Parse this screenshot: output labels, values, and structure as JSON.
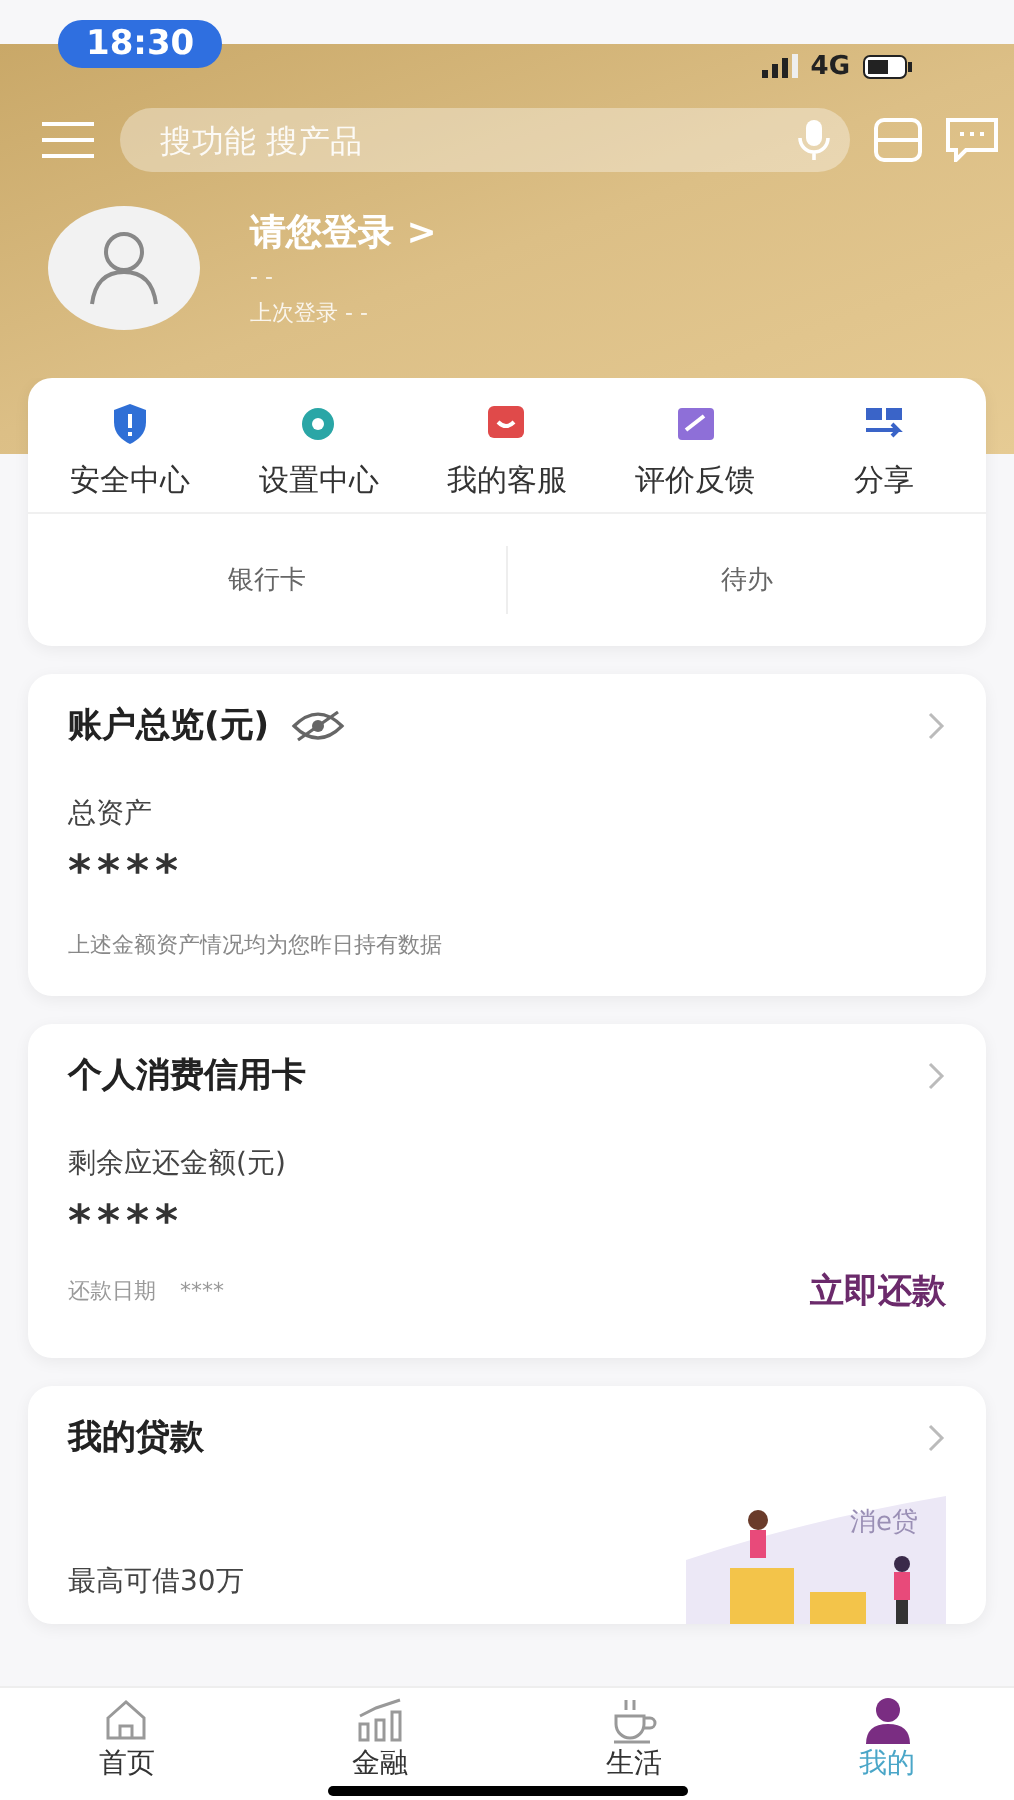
{
  "status_bar": {
    "time": "18:30",
    "network": "4G"
  },
  "search": {
    "placeholder": "搜功能 搜产品"
  },
  "profile": {
    "login": "请您登录",
    "chevron": ">",
    "id": "- -",
    "last_login": "上次登录 - -"
  },
  "shortcuts": [
    {
      "label": "安全中心"
    },
    {
      "label": "设置中心"
    },
    {
      "label": "我的客服"
    },
    {
      "label": "评价反馈"
    },
    {
      "label": "分享"
    }
  ],
  "quick_links": [
    "银行卡",
    "待办"
  ],
  "account": {
    "title": "账户总览(元)",
    "label": "总资产",
    "value": "****",
    "note": "上述金额资产情况均为您昨日持有数据"
  },
  "credit_card": {
    "title": "个人消费信用卡",
    "label": "剩余应还金额(元)",
    "value": "****",
    "due_label": "还款日期",
    "due_value": "****",
    "action": "立即还款"
  },
  "loan": {
    "title": "我的贷款",
    "subtitle": "最高可借30万",
    "banner_text": "消e贷"
  },
  "tabs": [
    {
      "label": "首页",
      "selected": false
    },
    {
      "label": "金融",
      "selected": false
    },
    {
      "label": "生活",
      "selected": false
    },
    {
      "label": "我的",
      "selected": true
    }
  ]
}
